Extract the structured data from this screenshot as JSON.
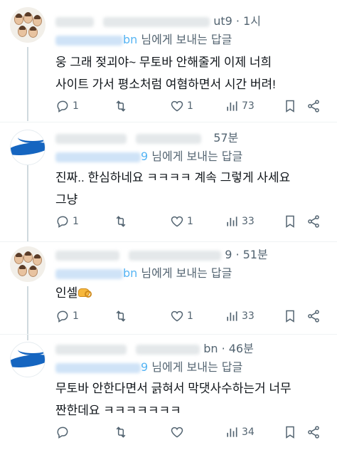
{
  "reply_to_suffix": "님에게 보내는 답글",
  "colors": {
    "link_blue": "#1d9bf0",
    "muted": "#536471",
    "text": "#0f1419"
  },
  "icons": {
    "reply": "speech-bubble-icon",
    "retweet": "retweet-icon",
    "like": "heart-icon",
    "views": "bar-chart-icon",
    "bookmark": "bookmark-icon",
    "share": "share-icon"
  },
  "tweets": [
    {
      "time": "1시",
      "handle_fragment": "ut9 · ",
      "reply_handle_fragment": "bn",
      "body_lines": [
        "웅 그래 젖괴야~ 무토바 안해줄게 이제 너희",
        "사이트 가서 평소처럼 여혐하면서 시간 버려!"
      ],
      "replies": "1",
      "retweets": "",
      "likes": "1",
      "views": "73"
    },
    {
      "time": "57분",
      "handle_fragment": "",
      "reply_handle_fragment": "9",
      "body_lines": [
        "진짜.. 한심하네요 ㅋㅋㅋㅋ 계속 그렇게 사세요",
        "그냥"
      ],
      "replies": "1",
      "retweets": "",
      "likes": "1",
      "views": "33"
    },
    {
      "time": "51분",
      "handle_fragment": "9 · ",
      "reply_handle_fragment": "bn",
      "body_lines": [
        "인셀"
      ],
      "replies": "1",
      "retweets": "",
      "likes": "1",
      "views": "33"
    },
    {
      "time": "46분",
      "handle_fragment": "bn · ",
      "reply_handle_fragment": "9",
      "body_lines": [
        "무토바 안한다면서 긁혀서 막댓사수하는거 너무",
        "짠한데요 ㅋㅋㅋㅋㅋㅋㅋ"
      ],
      "replies": "",
      "retweets": "",
      "likes": "",
      "views": "34"
    }
  ]
}
